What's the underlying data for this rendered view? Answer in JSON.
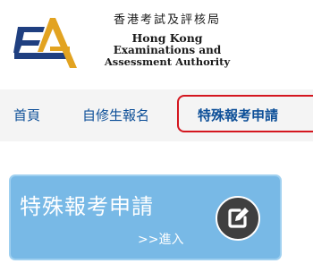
{
  "header": {
    "org_name_zh": "香港考試及評核局",
    "org_name_en_line1": "Hong Kong",
    "org_name_en_line2": "Examinations and",
    "org_name_en_line3": "Assessment Authority"
  },
  "nav": {
    "items": [
      {
        "label": "首頁"
      },
      {
        "label": "自修生報名"
      },
      {
        "label": "特殊報考申請",
        "active": true
      }
    ],
    "active_color": "#d4161f",
    "link_color": "#0d4f98"
  },
  "card": {
    "title": "特殊報考申請",
    "enter_label": ">>進入",
    "icon": "edit-icon",
    "background": "#78b9e6"
  }
}
